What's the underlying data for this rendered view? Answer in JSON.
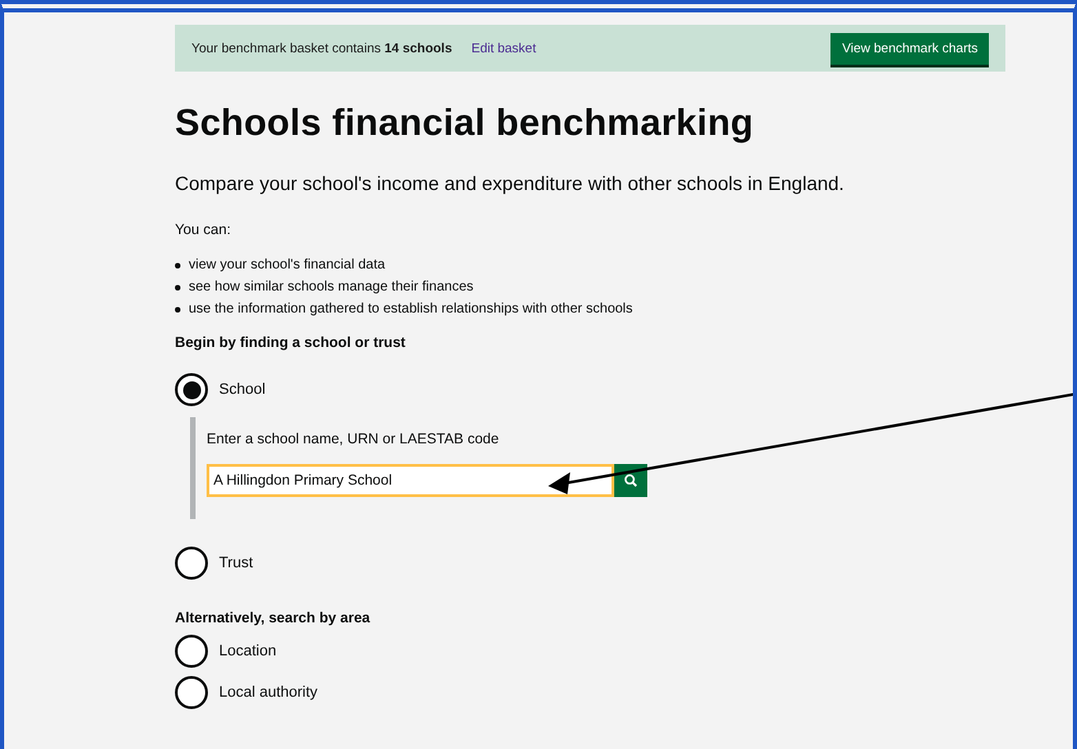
{
  "banner": {
    "text": "Your benchmark basket contains **14 schools**",
    "link": "Edit basket",
    "button": "View benchmark charts"
  },
  "heading": "Schools financial benchmarking",
  "lead": "Compare your school's income and expenditure with other schools in England.",
  "intro": "You can:",
  "bullets": [
    "view your school's financial data",
    "see how similar schools manage their finances",
    "use the information gathered to establish relationships with other schools"
  ],
  "find_heading": "Begin by finding a school or trust",
  "find_options": [
    {
      "label": "School",
      "selected": true,
      "search": {
        "label": "Enter a school name, URN or LAESTAB code",
        "value": "A Hillingdon Primary School"
      }
    },
    {
      "label": "Trust",
      "selected": false
    }
  ],
  "area_heading": "Alternatively, search by area",
  "area_options": [
    {
      "label": "Location",
      "selected": false
    },
    {
      "label": "Local authority",
      "selected": false
    }
  ]
}
